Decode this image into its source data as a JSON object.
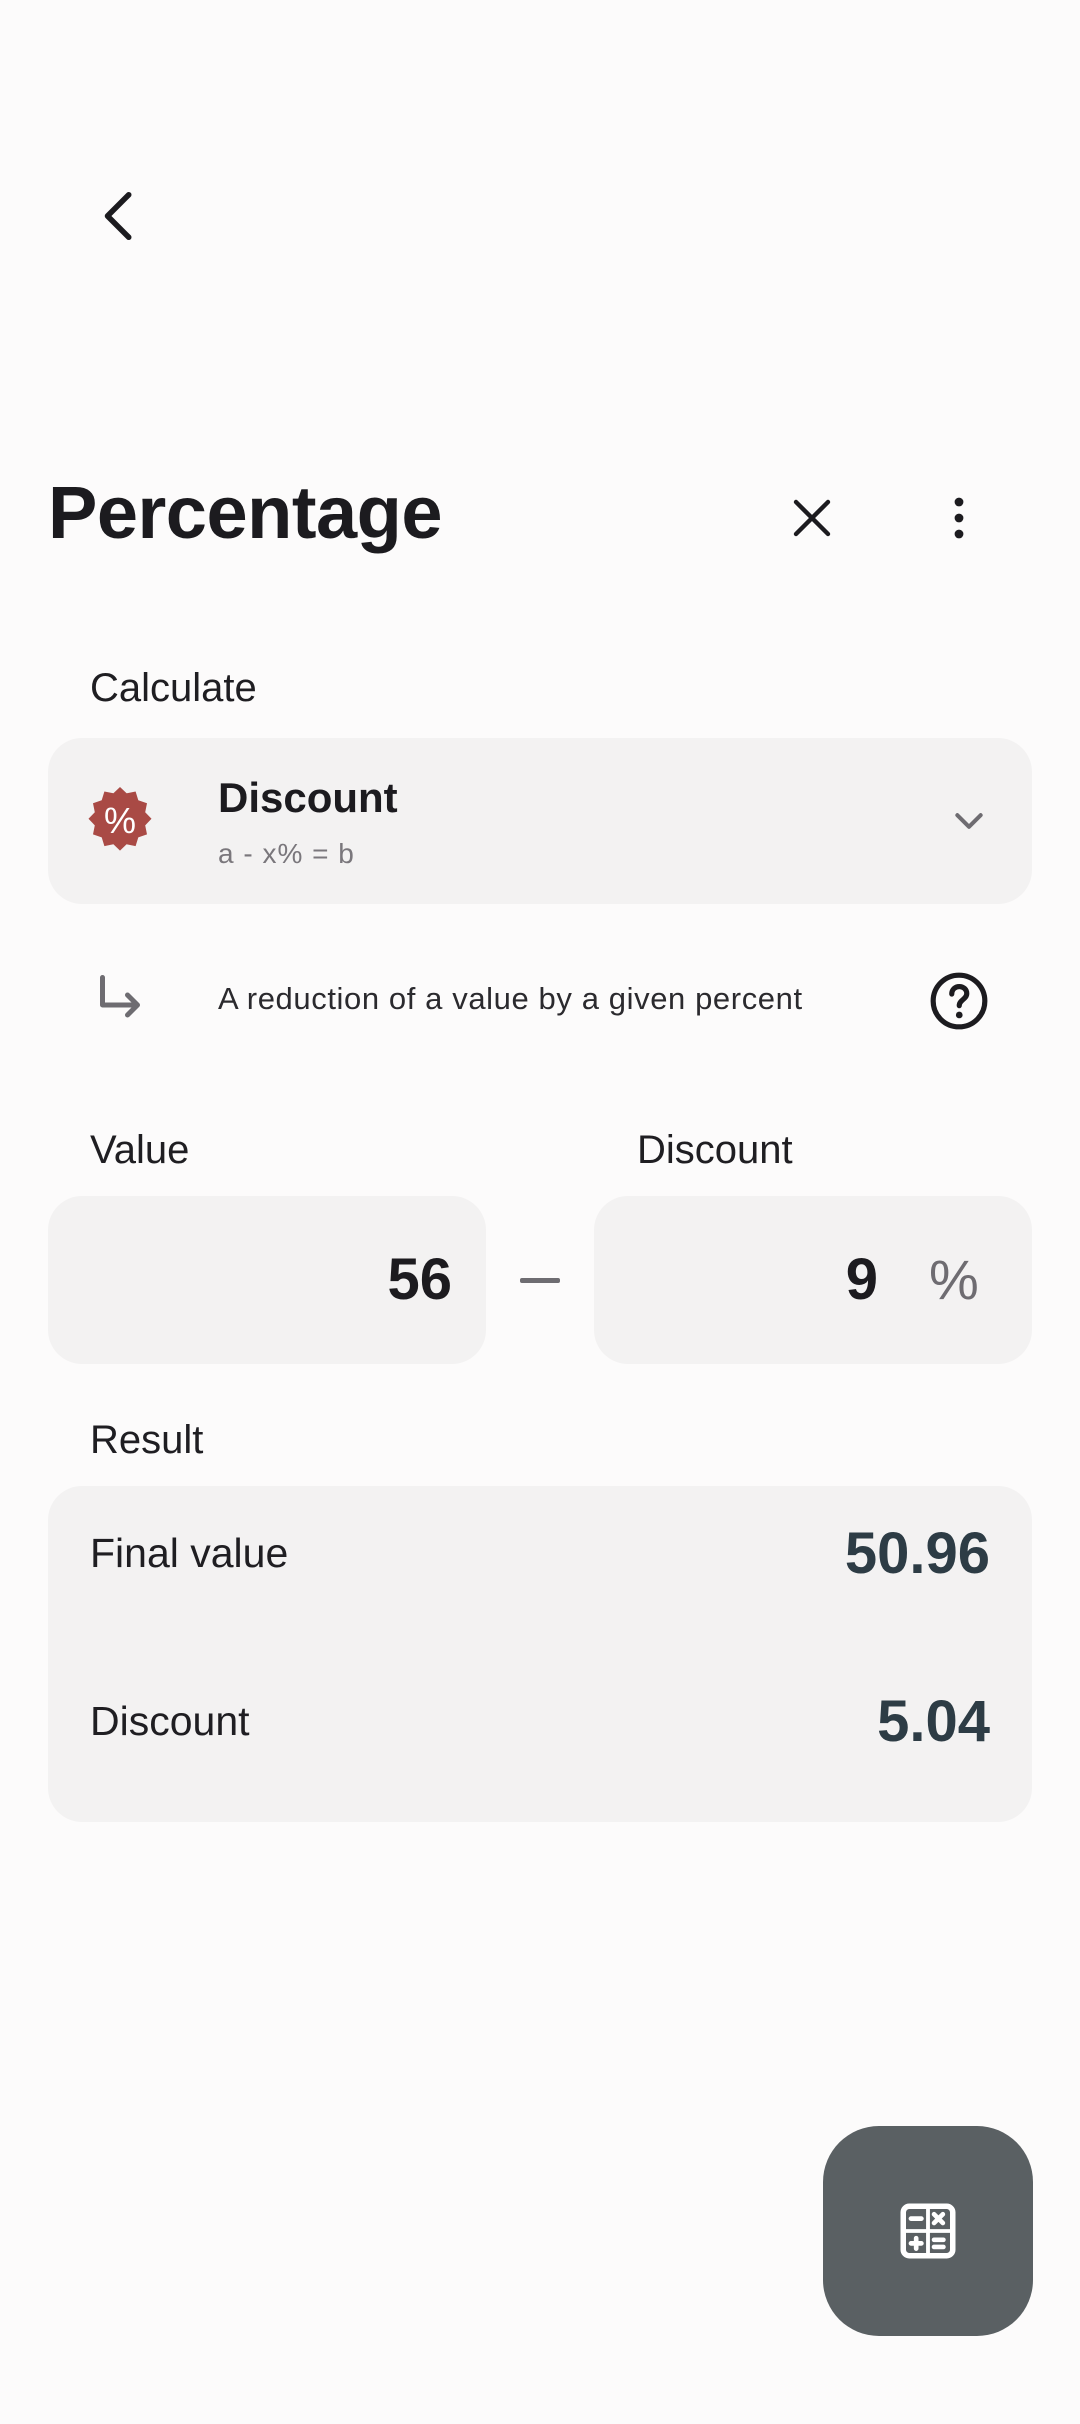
{
  "header": {
    "title": "Percentage"
  },
  "calculate": {
    "label": "Calculate",
    "mode": {
      "name": "Discount",
      "formula": "a - x% = b",
      "badge_color": "#a94a45"
    },
    "description": "A reduction of a value by a given percent"
  },
  "inputs": {
    "value_label": "Value",
    "value": "56",
    "discount_label": "Discount",
    "discount": "9",
    "percent_symbol": "%"
  },
  "result": {
    "label": "Result",
    "rows": [
      {
        "label": "Final value",
        "value": "50.96"
      },
      {
        "label": "Discount",
        "value": "5.04"
      }
    ]
  },
  "colors": {
    "background": "#fcfbfb",
    "card": "#f3f2f2",
    "result_value": "#2d3c45",
    "fab": "#5a6063"
  },
  "icons": {
    "back": "chevron-left-icon",
    "close": "close-icon",
    "more": "more-vertical-icon",
    "dropdown": "chevron-down-icon",
    "description": "subdirectory-arrow-right-icon",
    "help": "help-circle-icon",
    "fab": "calculator-icon"
  }
}
